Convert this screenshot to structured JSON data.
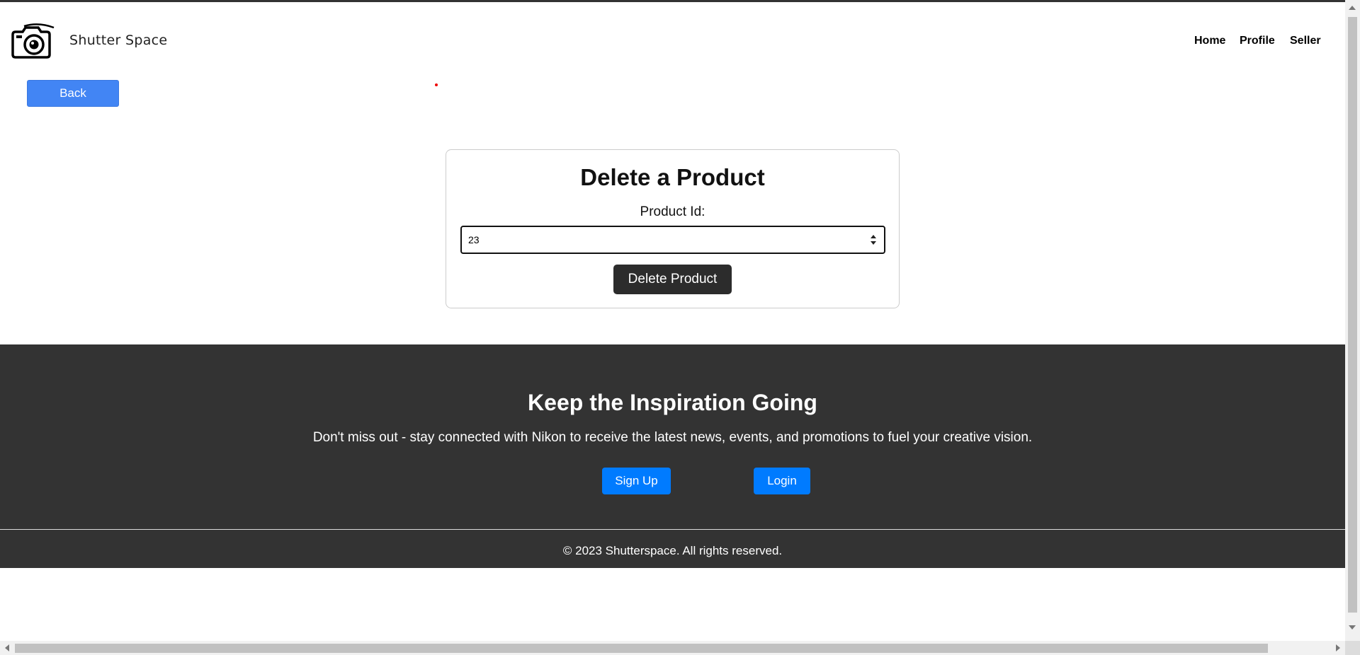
{
  "header": {
    "brand": "Shutter Space",
    "logo_icon": "camera-icon",
    "nav": [
      "Home",
      "Profile",
      "Seller"
    ]
  },
  "back_button": {
    "label": "Back"
  },
  "form": {
    "title": "Delete a Product",
    "field_label": "Product Id:",
    "product_id_value": "23",
    "submit_label": "Delete Product"
  },
  "footer": {
    "title": "Keep the Inspiration Going",
    "text": "Don't miss out - stay connected with Nikon to receive the latest news, events, and promotions to fuel your creative vision.",
    "signup_label": "Sign Up",
    "login_label": "Login",
    "copyright": "© 2023 Shutterspace. All rights reserved."
  },
  "colors": {
    "accent_blue": "#4285f4",
    "button_blue": "#007bff",
    "footer_bg": "#333333",
    "delete_button_bg": "#2c2c2c"
  }
}
